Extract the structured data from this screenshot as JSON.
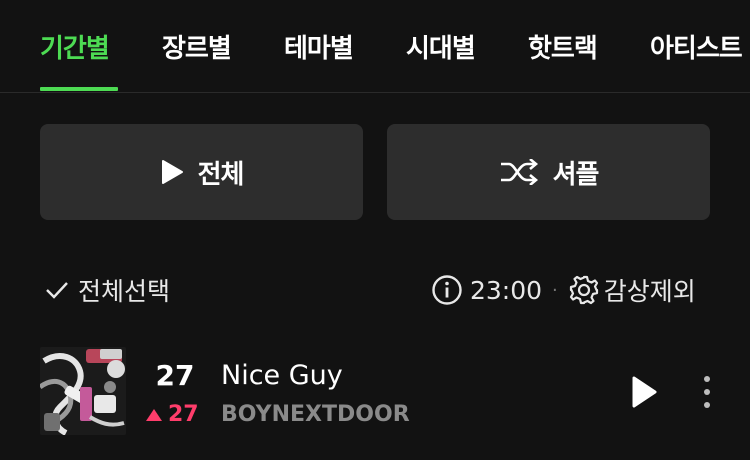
{
  "tabs": [
    {
      "label": "기간별",
      "active": true
    },
    {
      "label": "장르별"
    },
    {
      "label": "테마별"
    },
    {
      "label": "시대별"
    },
    {
      "label": "핫트랙"
    },
    {
      "label": "아티스트"
    }
  ],
  "actions": {
    "play_all_label": "전체",
    "shuffle_label": "셔플"
  },
  "toolbar": {
    "select_all_label": "전체선택",
    "time": "23:00",
    "exclude_label": "감상제외"
  },
  "song": {
    "rank": "27",
    "change": "27",
    "change_direction": "up",
    "title": "Nice Guy",
    "artist": "BOYNEXTDOOR"
  },
  "colors": {
    "accent": "#4ddb53",
    "rank_up": "#ff3d6b",
    "background": "#121212",
    "button_bg": "#2d2d2d"
  }
}
